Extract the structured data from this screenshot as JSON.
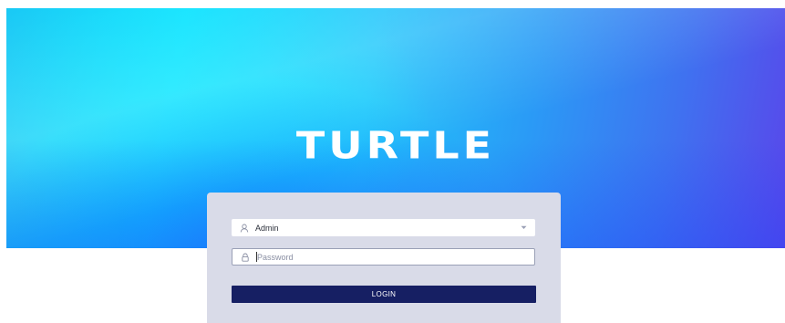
{
  "brand": {
    "name": "TURTLE"
  },
  "login_form": {
    "user_field": {
      "value": "Admin",
      "icon": "user-icon",
      "dropdown_icon": "caret-down-icon"
    },
    "password_field": {
      "placeholder": "Password",
      "value": "",
      "icon": "lock-icon"
    },
    "login_label": "LOGIN"
  },
  "colors": {
    "accent_button": "#161f63",
    "card_background": "#d9dbe8",
    "hero_cyan": "#0ee2ff",
    "hero_violet": "#5a45ea"
  }
}
